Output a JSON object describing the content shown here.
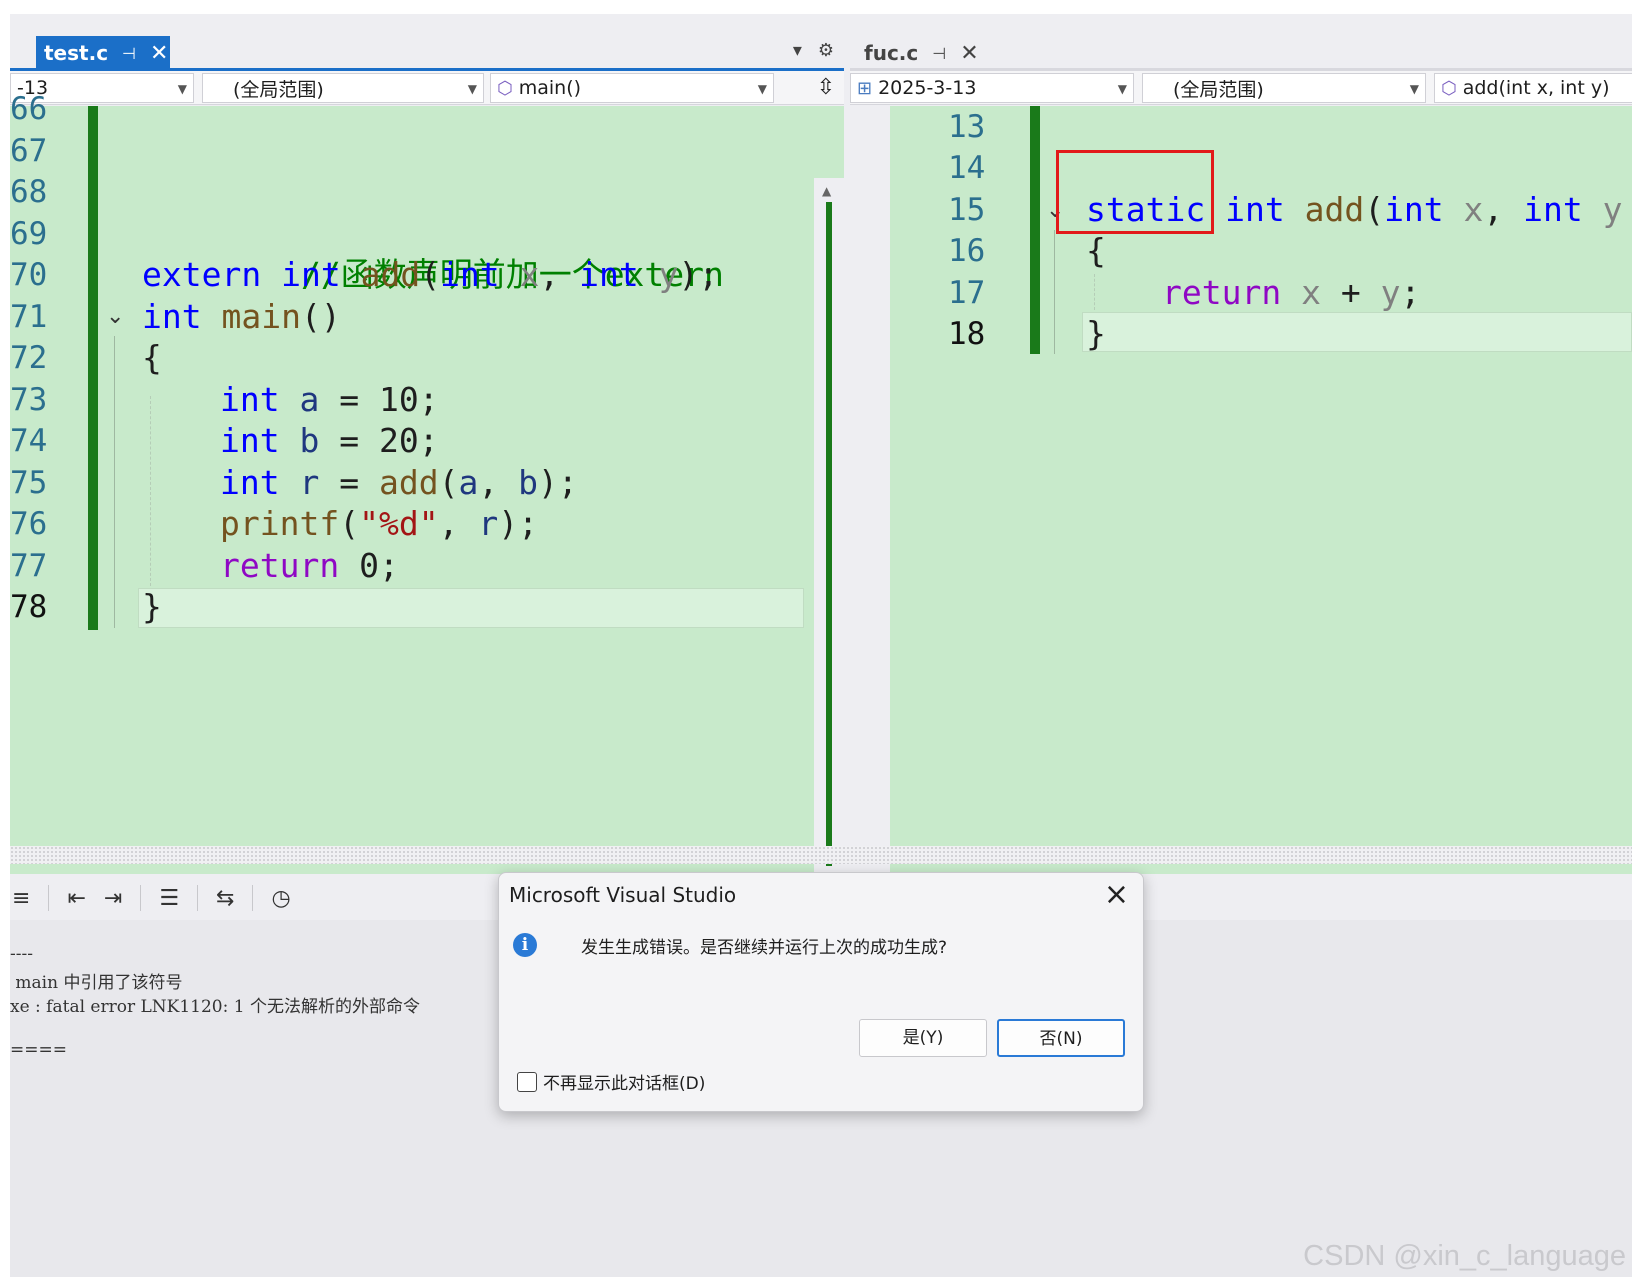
{
  "left_pane": {
    "tab": {
      "title": "test.c"
    },
    "nav": {
      "project": "-13",
      "scope": "(全局范围)",
      "member": "main()"
    },
    "lines": [
      {
        "num": "66"
      },
      {
        "num": "67"
      },
      {
        "num": "68"
      },
      {
        "num": "69"
      },
      {
        "num": "70"
      },
      {
        "num": "71"
      },
      {
        "num": "72"
      },
      {
        "num": "73"
      },
      {
        "num": "74"
      },
      {
        "num": "75"
      },
      {
        "num": "76"
      },
      {
        "num": "77"
      },
      {
        "num": "78"
      }
    ],
    "code": {
      "l69": "//函数声明前加一个extern",
      "l70_extern": "extern",
      "l70_int": "int",
      "l70_fn": "add",
      "l70_p1": "(",
      "l70_int2": "int",
      "l70_x": "x",
      "l70_c": ", ",
      "l70_int3": "int",
      "l70_y": "y",
      "l70_end": ");",
      "l71_int": "int",
      "l71_fn": "main",
      "l71_end": "()",
      "l72": "{",
      "l73_int": "int",
      "l73_var": "a",
      "l73_eq": " = ",
      "l73_val": "10;",
      "l74_int": "int",
      "l74_var": "b",
      "l74_eq": " = ",
      "l74_val": "20;",
      "l75_int": "int",
      "l75_var": "r",
      "l75_eq": " = ",
      "l75_fn": "add",
      "l75_p": "(",
      "l75_a": "a",
      "l75_c": ", ",
      "l75_b": "b",
      "l75_end": ");",
      "l76_fn": "printf",
      "l76_p": "(",
      "l76_str": "\"%d\"",
      "l76_c": ", ",
      "l76_r": "r",
      "l76_end": ");",
      "l77_ret": "return",
      "l77_val": " 0;",
      "l78": "}"
    }
  },
  "right_pane": {
    "tab": {
      "title": "fuc.c"
    },
    "nav": {
      "project": "2025-3-13",
      "scope": "(全局范围)",
      "member": "add(int x, int y)"
    },
    "lines": [
      {
        "num": "13"
      },
      {
        "num": "14"
      },
      {
        "num": "15"
      },
      {
        "num": "16"
      },
      {
        "num": "17"
      },
      {
        "num": "18"
      }
    ],
    "code": {
      "l15_static": "static",
      "l15_int": "int",
      "l15_fn": "add",
      "l15_p": "(",
      "l15_int2": "int",
      "l15_x": "x",
      "l15_c": ", ",
      "l15_int3": "int",
      "l15_y": "y",
      "l16": "{",
      "l17_ret": "return",
      "l17_x": "x",
      "l17_plus": " + ",
      "l17_y": "y",
      "l17_end": ";",
      "l18": "}"
    }
  },
  "output": {
    "lines": [
      "----",
      " main 中引用了该符号",
      "xe : fatal error LNK1120: 1 个无法解析的外部命令",
      "",
      "===="
    ]
  },
  "dialog": {
    "title": "Microsoft Visual Studio",
    "message": "发生生成错误。是否继续并运行上次的成功生成?",
    "yes_label": "是(Y)",
    "no_label": "否(N)",
    "checkbox_label": "不再显示此对话框(D)"
  },
  "watermark": "CSDN @xin_c_language",
  "colors": {
    "editor_bg": "#c8eacb",
    "change_bar": "#1a7a1a",
    "active_tab": "#1b6fc8",
    "highlight_box": "#e21a1a"
  }
}
